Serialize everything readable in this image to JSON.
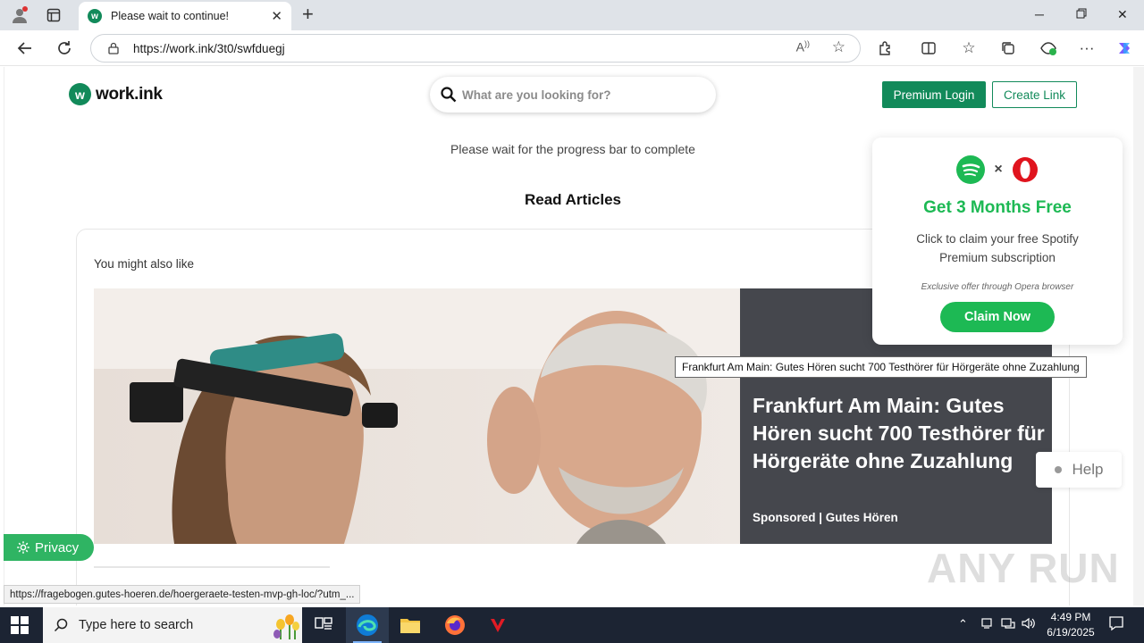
{
  "browser": {
    "tab_title": "Please wait to continue!",
    "tab_favicon_letter": "w",
    "url": "https://work.ink/3t0/swfduegj",
    "read_aloud_label": "A̅",
    "status_url": "https://fragebogen.gutes-hoeren.de/hoergeraete-testen-mvp-gh-loc/?utm_..."
  },
  "site": {
    "logo_letter": "w",
    "logo_text": "work.ink",
    "search_placeholder": "What are you looking for?",
    "premium_login": "Premium Login",
    "create_link": "Create Link",
    "wait_text": "Please wait for the progress bar to complete",
    "read_articles": "Read Articles",
    "might_like": "You might also like",
    "article": {
      "title": "Frankfurt Am Main: Gutes Hören sucht 700 Testhörer für Hörgeräte ohne Zuzahlung",
      "sponsor": "Sponsored | Gutes Hören"
    },
    "tooltip": "Frankfurt Am Main: Gutes Hören sucht 700 Testhörer für Hörgeräte ohne Zuzahlung",
    "promo": {
      "times": "×",
      "headline": "Get 3 Months Free",
      "description": "Click to claim your free Spotify Premium subscription",
      "exclusive": "Exclusive offer through Opera browser",
      "claim": "Claim Now"
    },
    "help": "Help",
    "privacy": "Privacy",
    "watermark": "ANY RUN"
  },
  "taskbar": {
    "search_placeholder": "Type here to search",
    "time": "4:49 PM",
    "date": "6/19/2025"
  },
  "colors": {
    "brand_green": "#128a5a",
    "spotify_green": "#1db954",
    "privacy_green": "#2fb463",
    "article_panel": "#45474d",
    "taskbar": "#1c2433"
  }
}
